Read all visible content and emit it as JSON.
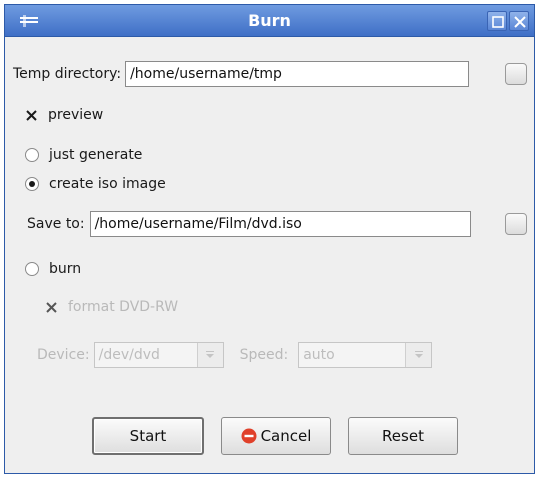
{
  "window": {
    "title": "Burn"
  },
  "temp_directory": {
    "label": "Temp directory:",
    "value": "/home/username/tmp"
  },
  "preview": {
    "label": "preview",
    "checked": true
  },
  "mode": {
    "just_generate": {
      "label": "just generate",
      "selected": false
    },
    "create_iso": {
      "label": "create iso image",
      "selected": true
    },
    "burn": {
      "label": "burn",
      "selected": false
    }
  },
  "save_to": {
    "label": "Save to:",
    "value": "/home/username/Film/dvd.iso"
  },
  "format_dvd": {
    "label": "format DVD-RW",
    "checked": true,
    "enabled": false
  },
  "device": {
    "label": "Device:",
    "value": "/dev/dvd",
    "enabled": false
  },
  "speed": {
    "label": "Speed:",
    "value": "auto",
    "enabled": false
  },
  "buttons": {
    "start": "Start",
    "cancel": "Cancel",
    "reset": "Reset"
  },
  "colors": {
    "titlebar": "#4a7bd0",
    "cancel_icon": "#e0402a"
  }
}
